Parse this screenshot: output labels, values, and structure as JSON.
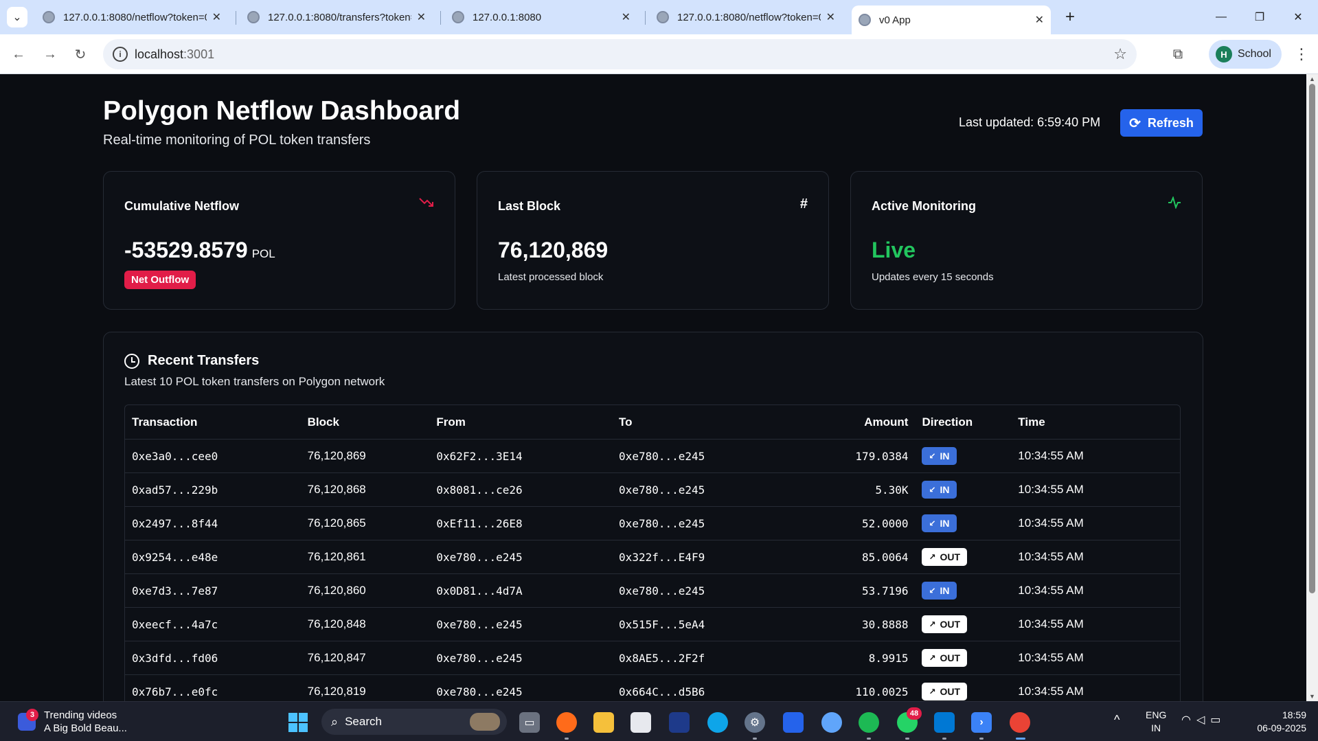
{
  "browser": {
    "tabs": [
      {
        "title": "127.0.0.1:8080/netflow?token=0",
        "active": false
      },
      {
        "title": "127.0.0.1:8080/transfers?token=",
        "active": false
      },
      {
        "title": "127.0.0.1:8080",
        "active": false
      },
      {
        "title": "127.0.0.1:8080/netflow?token=0",
        "active": false
      },
      {
        "title": "v0 App",
        "active": true
      }
    ],
    "url_host": "localhost",
    "url_port": ":3001",
    "profile_initial": "H",
    "profile_name": "School"
  },
  "header": {
    "title": "Polygon Netflow Dashboard",
    "subtitle": "Real-time monitoring of POL token transfers",
    "last_updated": "Last updated: 6:59:40 PM",
    "refresh_label": "Refresh"
  },
  "cards": {
    "netflow": {
      "label": "Cumulative Netflow",
      "value": "-53529.8579",
      "unit": "POL",
      "badge": "Net Outflow",
      "icon": "trending-down-icon",
      "icon_color": "#e11d48"
    },
    "block": {
      "label": "Last Block",
      "value": "76,120,869",
      "note": "Latest processed block",
      "icon": "hash-icon"
    },
    "monitoring": {
      "label": "Active Monitoring",
      "value": "Live",
      "note": "Updates every 15 seconds",
      "icon": "activity-icon",
      "value_color": "#22c55e"
    }
  },
  "transfers": {
    "title": "Recent Transfers",
    "subtitle": "Latest 10 POL token transfers on Polygon network",
    "columns": [
      "Transaction",
      "Block",
      "From",
      "To",
      "Amount",
      "Direction",
      "Time"
    ],
    "rows": [
      {
        "tx": "0xe3a0...cee0",
        "block": "76,120,869",
        "from": "0x62F2...3E14",
        "to": "0xe780...e245",
        "amount": "179.0384",
        "direction": "IN",
        "time": "10:34:55 AM"
      },
      {
        "tx": "0xad57...229b",
        "block": "76,120,868",
        "from": "0x8081...ce26",
        "to": "0xe780...e245",
        "amount": "5.30K",
        "direction": "IN",
        "time": "10:34:55 AM"
      },
      {
        "tx": "0x2497...8f44",
        "block": "76,120,865",
        "from": "0xEf11...26E8",
        "to": "0xe780...e245",
        "amount": "52.0000",
        "direction": "IN",
        "time": "10:34:55 AM"
      },
      {
        "tx": "0x9254...e48e",
        "block": "76,120,861",
        "from": "0xe780...e245",
        "to": "0x322f...E4F9",
        "amount": "85.0064",
        "direction": "OUT",
        "time": "10:34:55 AM"
      },
      {
        "tx": "0xe7d3...7e87",
        "block": "76,120,860",
        "from": "0x0D81...4d7A",
        "to": "0xe780...e245",
        "amount": "53.7196",
        "direction": "IN",
        "time": "10:34:55 AM"
      },
      {
        "tx": "0xeecf...4a7c",
        "block": "76,120,848",
        "from": "0xe780...e245",
        "to": "0x515F...5eA4",
        "amount": "30.8888",
        "direction": "OUT",
        "time": "10:34:55 AM"
      },
      {
        "tx": "0x3dfd...fd06",
        "block": "76,120,847",
        "from": "0xe780...e245",
        "to": "0x8AE5...2F2f",
        "amount": "8.9915",
        "direction": "OUT",
        "time": "10:34:55 AM"
      },
      {
        "tx": "0x76b7...e0fc",
        "block": "76,120,819",
        "from": "0xe780...e245",
        "to": "0x664C...d5B6",
        "amount": "110.0025",
        "direction": "OUT",
        "time": "10:34:55 AM"
      }
    ]
  },
  "taskbar": {
    "widget_title": "Trending videos",
    "widget_sub": "A Big Bold Beau...",
    "widget_badge": "3",
    "search_label": "Search",
    "whatsapp_badge": "48",
    "lang_top": "ENG",
    "lang_bottom": "IN",
    "time": "18:59",
    "date": "06-09-2025"
  }
}
